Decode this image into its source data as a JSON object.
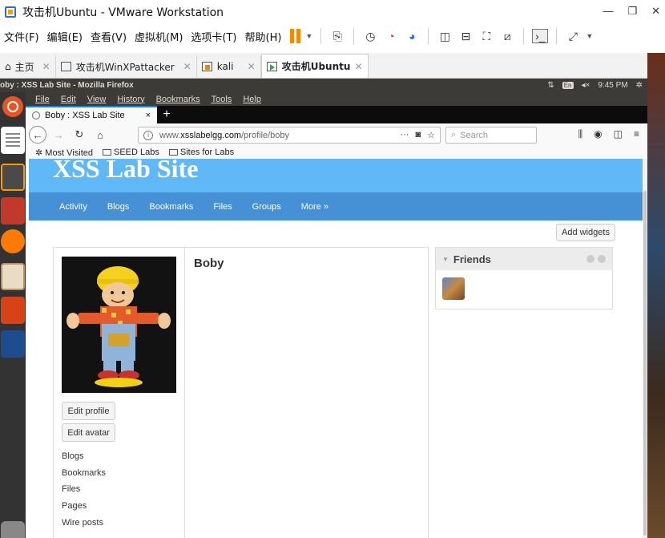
{
  "window": {
    "title": "攻击机Ubuntu - VMware Workstation",
    "controls": [
      "—",
      "❐",
      "✕"
    ]
  },
  "vm_menu": [
    "文件(F)",
    "编辑(E)",
    "查看(V)",
    "虚拟机(M)",
    "选项卡(T)",
    "帮助(H)"
  ],
  "vm_tabs": [
    {
      "label": "主页",
      "close": "✕"
    },
    {
      "label": "攻击机WinXPattacker",
      "close": "✕"
    },
    {
      "label": "kali",
      "close": "✕"
    },
    {
      "label": "攻击机Ubuntu",
      "close": "✕"
    }
  ],
  "ubuntu_panel": {
    "window_title": "oby : XSS Lab Site - Mozilla Firefox",
    "keyboard": "En",
    "time": "9:45 PM"
  },
  "firefox_menu": [
    "File",
    "Edit",
    "View",
    "History",
    "Bookmarks",
    "Tools",
    "Help"
  ],
  "firefox_tab": {
    "label": "Boby : XSS Lab Site",
    "close": "×",
    "new": "+"
  },
  "url": {
    "prefix": "www.",
    "domain": "xsslabelgg.com",
    "path": "/profile/boby",
    "more": "···"
  },
  "search": {
    "placeholder": "Search"
  },
  "bookmarks": [
    {
      "label": "Most Visited"
    },
    {
      "label": "SEED Labs"
    },
    {
      "label": "Sites for Labs"
    }
  ],
  "site": {
    "name": "XSS Lab Site",
    "nav": [
      "Activity",
      "Blogs",
      "Bookmarks",
      "Files",
      "Groups",
      "More »"
    ],
    "add_widgets": "Add widgets"
  },
  "profile": {
    "name": "Boby",
    "edit_profile": "Edit profile",
    "edit_avatar": "Edit avatar",
    "links": [
      "Blogs",
      "Bookmarks",
      "Files",
      "Pages",
      "Wire posts"
    ]
  },
  "friends_widget": {
    "title": "Friends"
  }
}
